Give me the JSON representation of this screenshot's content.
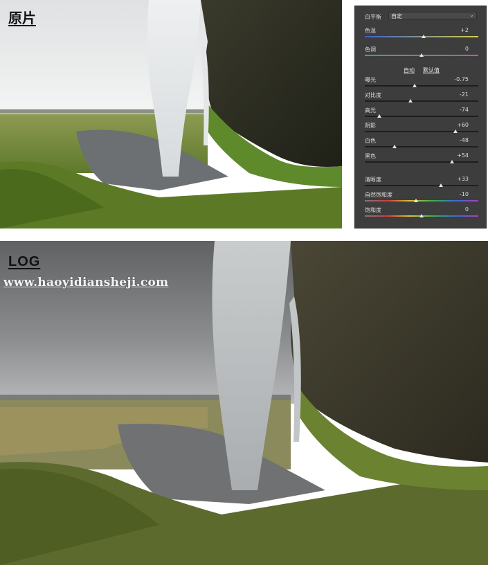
{
  "labels": {
    "top_photo": "原片",
    "bottom_photo": "LOG",
    "watermark": "www.haoyidiansheji.com"
  },
  "panel": {
    "white_balance": {
      "label": "白平衡",
      "value": "自定",
      "icon": "chevron-down-icon"
    },
    "auto_links": {
      "auto": "自动",
      "default": "默认值"
    },
    "sliders": [
      {
        "key": "temperature",
        "label": "色温",
        "value": "+2",
        "position": 0.52,
        "track": "temperature"
      },
      {
        "key": "tint",
        "label": "色调",
        "value": "0",
        "position": 0.5,
        "track": "tint"
      },
      {
        "key": "exposure",
        "label": "曝光",
        "value": "-0.75",
        "position": 0.44,
        "track": "plain"
      },
      {
        "key": "contrast",
        "label": "对比度",
        "value": "-21",
        "position": 0.4,
        "track": "plain"
      },
      {
        "key": "highlights",
        "label": "高光",
        "value": "-74",
        "position": 0.13,
        "track": "plain"
      },
      {
        "key": "shadows",
        "label": "阴影",
        "value": "+60",
        "position": 0.8,
        "track": "plain"
      },
      {
        "key": "whites",
        "label": "白色",
        "value": "-48",
        "position": 0.26,
        "track": "plain"
      },
      {
        "key": "blacks",
        "label": "黑色",
        "value": "+54",
        "position": 0.77,
        "track": "plain"
      },
      {
        "key": "clarity",
        "label": "清晰度",
        "value": "+33",
        "position": 0.67,
        "track": "plain"
      },
      {
        "key": "vibrance",
        "label": "自然饱和度",
        "value": "-10",
        "position": 0.45,
        "track": "saturation"
      },
      {
        "key": "saturation",
        "label": "饱和度",
        "value": "0",
        "position": 0.5,
        "track": "saturation"
      }
    ]
  },
  "colors": {
    "panel_bg": "#3d3d3d",
    "panel_text": "#d8d8d8"
  }
}
